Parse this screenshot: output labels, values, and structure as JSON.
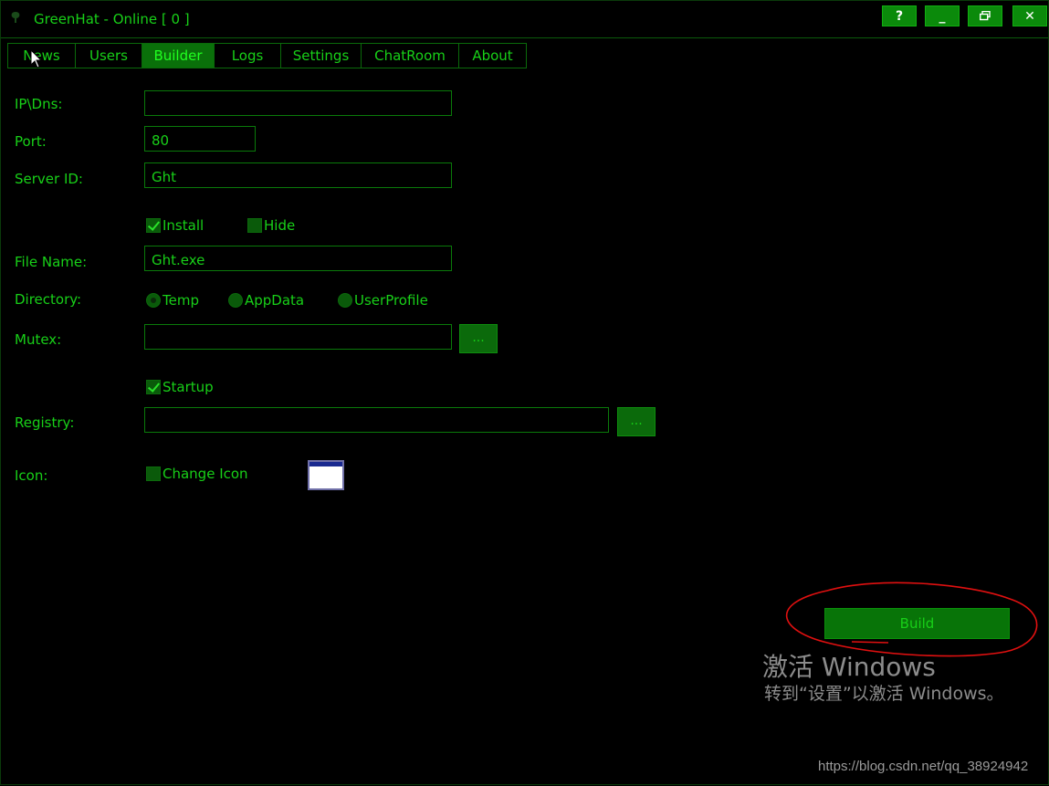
{
  "window": {
    "title": "GreenHat - Online [ 0 ]",
    "buttons": {
      "help": "?",
      "minimize": "_",
      "restore": "🗗",
      "close": "✕"
    }
  },
  "tabs": [
    {
      "label": "News"
    },
    {
      "label": "Users"
    },
    {
      "label": "Builder",
      "active": true
    },
    {
      "label": "Logs"
    },
    {
      "label": "Settings"
    },
    {
      "label": "ChatRoom"
    },
    {
      "label": "About"
    }
  ],
  "form": {
    "ip_label": "IP\\Dns:",
    "ip_value": "",
    "port_label": "Port:",
    "port_value": "80",
    "server_id_label": "Server ID:",
    "server_id_value": "Ght",
    "install_label": "Install",
    "install_checked": true,
    "hide_label": "Hide",
    "hide_checked": false,
    "file_name_label": "File Name:",
    "file_name_value": "Ght.exe",
    "directory_label": "Directory:",
    "directory_options": [
      "Temp",
      "AppData",
      "UserProfile"
    ],
    "directory_selected": "Temp",
    "mutex_label": "Mutex:",
    "mutex_value": "",
    "browse_label": "...",
    "startup_label": "Startup",
    "startup_checked": true,
    "registry_label": "Registry:",
    "registry_value": "",
    "icon_label": "Icon:",
    "change_icon_label": "Change Icon",
    "change_icon_checked": false
  },
  "build_label": "Build",
  "watermark": {
    "line1": "激活 Windows",
    "line2": "转到“设置”以激活 Windows。"
  },
  "url_text": "https://blog.csdn.net/qq_38924942",
  "colors": {
    "accent": "#18d018",
    "button_bg": "#0b6a0b",
    "annotation": "#e01010"
  }
}
